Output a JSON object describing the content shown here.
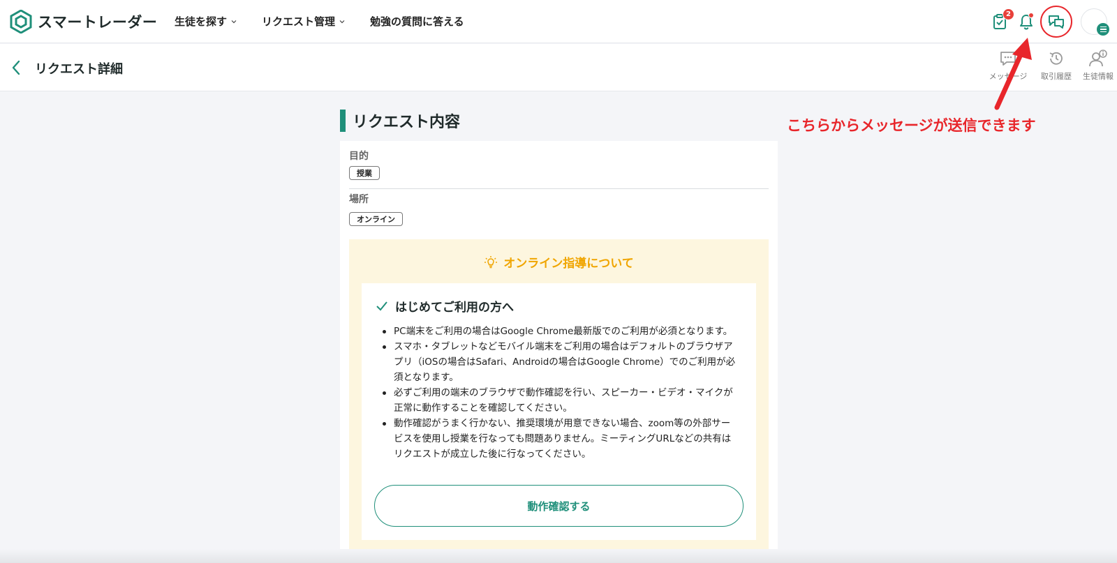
{
  "header": {
    "logo_text": "スマートレーダー",
    "nav": [
      {
        "label": "生徒を探す",
        "has_dropdown": true
      },
      {
        "label": "リクエスト管理",
        "has_dropdown": true
      },
      {
        "label": "勉強の質問に答える",
        "has_dropdown": false
      }
    ],
    "icons": {
      "task": {
        "icon": "clipboard-check-icon",
        "badge": "2"
      },
      "notification": {
        "icon": "bell-icon",
        "has_dot": true
      },
      "messages": {
        "icon": "chat-bubbles-icon",
        "highlighted": true
      },
      "avatar": {
        "icon": "avatar",
        "menu_icon": "menu-icon"
      }
    },
    "accent_color": "#1f8f7a"
  },
  "subheader": {
    "title": "リクエスト詳細",
    "actions": [
      {
        "label": "メッセージ",
        "icon": "message-bubble-icon"
      },
      {
        "label": "取引履歴",
        "icon": "history-icon"
      },
      {
        "label": "生徒情報",
        "icon": "student-info-icon"
      }
    ]
  },
  "main": {
    "section_title": "リクエスト内容",
    "fields": {
      "purpose_label": "目的",
      "purpose_value": "授業",
      "place_label": "場所",
      "place_value": "オンライン"
    },
    "online_guide": {
      "title": "オンライン指導について",
      "first_time_title": "はじめてご利用の方へ",
      "notes": [
        "PC端末をご利用の場合はGoogle Chrome最新版でのご利用が必須となります。",
        "スマホ・タブレットなどモバイル端末をご利用の場合はデフォルトのブラウザアプリ（iOSの場合はSafari、Androidの場合はGoogle Chrome）でのご利用が必須となります。",
        "必ずご利用の端末のブラウザで動作確認を行い、スピーカー・ビデオ・マイクが正常に動作することを確認してください。",
        "動作確認がうまく行かない、推奨環境が用意できない場合、zoom等の外部サービスを使用し授業を行なっても問題ありません。ミーティングURLなどの共有はリクエストが成立した後に行なってください。"
      ],
      "check_button": "動作確認する",
      "bg_color": "#fdf6df",
      "title_color": "#f0a500"
    }
  },
  "annotation": {
    "text": "こちらからメッセージが送信できます",
    "color": "#e8262b"
  }
}
